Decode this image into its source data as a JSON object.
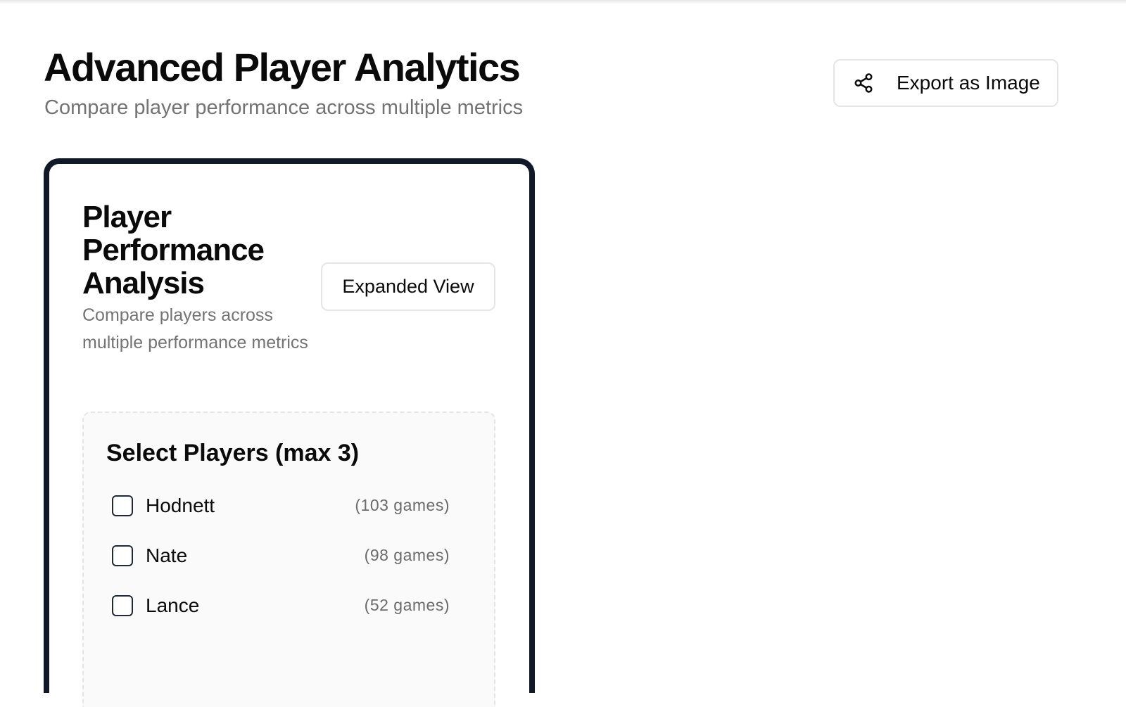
{
  "header": {
    "title": "Advanced Player Analytics",
    "subtitle": "Compare player performance across multiple metrics",
    "export_button": {
      "label": "Export as Image",
      "icon": "share-icon"
    }
  },
  "card": {
    "title": "Player Performance Analysis",
    "subtitle": "Compare players across multiple performance metrics",
    "view_button": {
      "label": "Expanded View"
    },
    "select_panel": {
      "title": "Select Players (max 3)",
      "players": [
        {
          "name": "Hodnett",
          "games": "(103 games)",
          "checked": false
        },
        {
          "name": "Nate",
          "games": "(98 games)",
          "checked": false
        },
        {
          "name": "Lance",
          "games": "(52 games)",
          "checked": false
        }
      ]
    }
  }
}
